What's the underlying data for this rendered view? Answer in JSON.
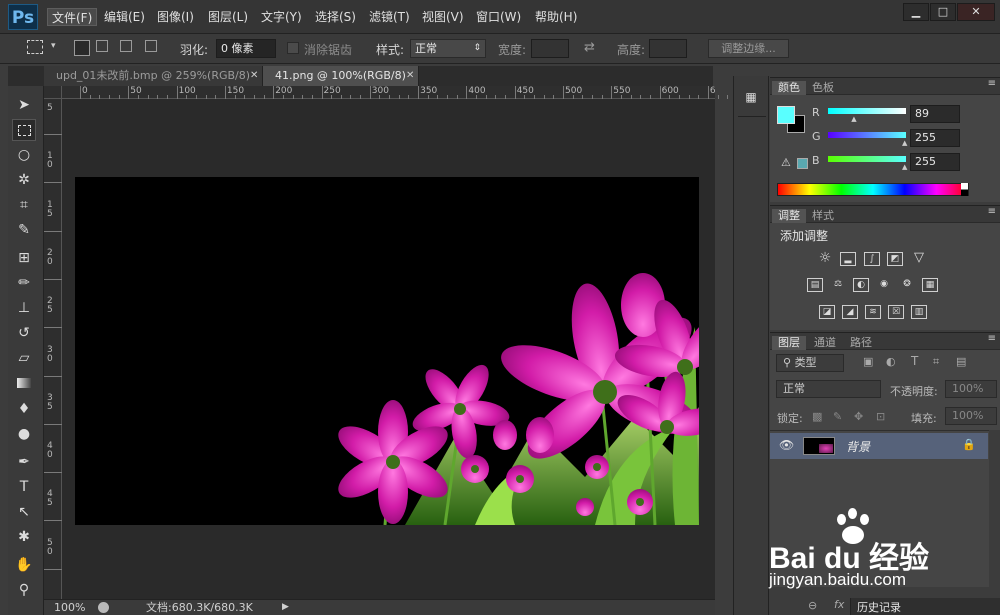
{
  "app": {
    "logo": "Ps"
  },
  "menu": [
    "文件(F)",
    "编辑(E)",
    "图像(I)",
    "图层(L)",
    "文字(Y)",
    "选择(S)",
    "滤镜(T)",
    "视图(V)",
    "窗口(W)",
    "帮助(H)"
  ],
  "window_controls": {
    "minimize": "▁",
    "maximize": "□",
    "close": "✕"
  },
  "options": {
    "feather_label": "羽化:",
    "feather_value": "0 像素",
    "antialias_label": "消除锯齿",
    "style_label": "样式:",
    "style_value": "正常",
    "width_label": "宽度:",
    "height_label": "高度:",
    "refine_edge": "调整边缘..."
  },
  "tabs": [
    {
      "label": "upd_01未改前.bmp @ 259%(RGB/8)",
      "active": false
    },
    {
      "label": "41.png @ 100%(RGB/8)",
      "active": true
    }
  ],
  "ruler": {
    "top": [
      "0",
      "50",
      "100",
      "150",
      "200",
      "250",
      "300",
      "350",
      "400",
      "450",
      "500",
      "550",
      "600",
      "6"
    ],
    "left": [
      "5",
      "1 0",
      "1 5",
      "2 0",
      "2 5",
      "3 0",
      "3 5",
      "4 0",
      "4 5",
      "5 0"
    ]
  },
  "status": {
    "zoom": "100%",
    "doc_info": "文档:680.3K/680.3K"
  },
  "color_panel": {
    "tabs": [
      "颜色",
      "色板"
    ],
    "foreground": "#59ffff",
    "background": "#000000",
    "r_label": "R",
    "g_label": "G",
    "b_label": "B",
    "r": "89",
    "g": "255",
    "b": "255",
    "r_fraction": 0.35,
    "g_fraction": 1.0,
    "b_fraction": 1.0
  },
  "adjust_panel": {
    "tabs": [
      "调整",
      "样式"
    ],
    "title": "添加调整"
  },
  "layers_panel": {
    "tabs": [
      "图层",
      "通道",
      "路径"
    ],
    "filter_kind": "类型",
    "blend_mode": "正常",
    "opacity_label": "不透明度:",
    "opacity": "100%",
    "lock_label": "锁定:",
    "fill_label": "填充:",
    "fill": "100%",
    "layer_name": "背景"
  },
  "history_tab": "历史记录",
  "watermark": {
    "brand": "Bai du 经验",
    "url": "jingyan.baidu.com"
  }
}
